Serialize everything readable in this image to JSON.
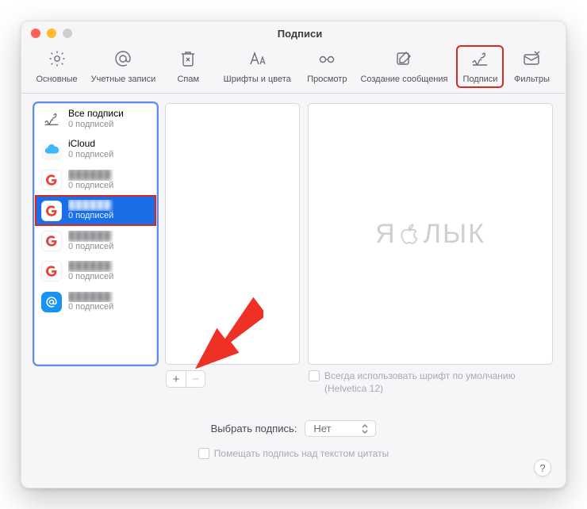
{
  "window": {
    "title": "Подписи"
  },
  "toolbar": {
    "general": "Основные",
    "accounts": "Учетные записи",
    "spam": "Спам",
    "fonts": "Шрифты и цвета",
    "view": "Просмотр",
    "compose": "Создание сообщения",
    "sigs": "Подписи",
    "filters": "Фильтры"
  },
  "accounts": [
    {
      "name": "Все подписи",
      "sub": "0 подписей",
      "icon": "all",
      "selected": false,
      "blurred": false
    },
    {
      "name": "iCloud",
      "sub": "0 подписей",
      "icon": "icloud",
      "selected": false,
      "blurred": false
    },
    {
      "name": "blurred",
      "sub": "0 подписей",
      "icon": "google",
      "selected": false,
      "blurred": true
    },
    {
      "name": "blurred",
      "sub": "0 подписей",
      "icon": "google",
      "selected": true,
      "blurred": true
    },
    {
      "name": "blurred",
      "sub": "0 подписей",
      "icon": "google",
      "selected": false,
      "blurred": true
    },
    {
      "name": "blurred",
      "sub": "0 подписей",
      "icon": "google",
      "selected": false,
      "blurred": true
    },
    {
      "name": "blurred",
      "sub": "0 подписей",
      "icon": "at",
      "selected": false,
      "blurred": true
    }
  ],
  "buttons": {
    "add": "+",
    "remove": "−"
  },
  "defaultFont": {
    "label": "Всегда использовать шрифт по умолчанию",
    "note": "(Helvetica 12)"
  },
  "choose": {
    "label": "Выбрать подпись:",
    "value": "Нет"
  },
  "place": {
    "label": "Помещать подпись над текстом цитаты"
  },
  "help": "?",
  "watermark": {
    "left": "Я",
    "right": "ЛЫК"
  }
}
